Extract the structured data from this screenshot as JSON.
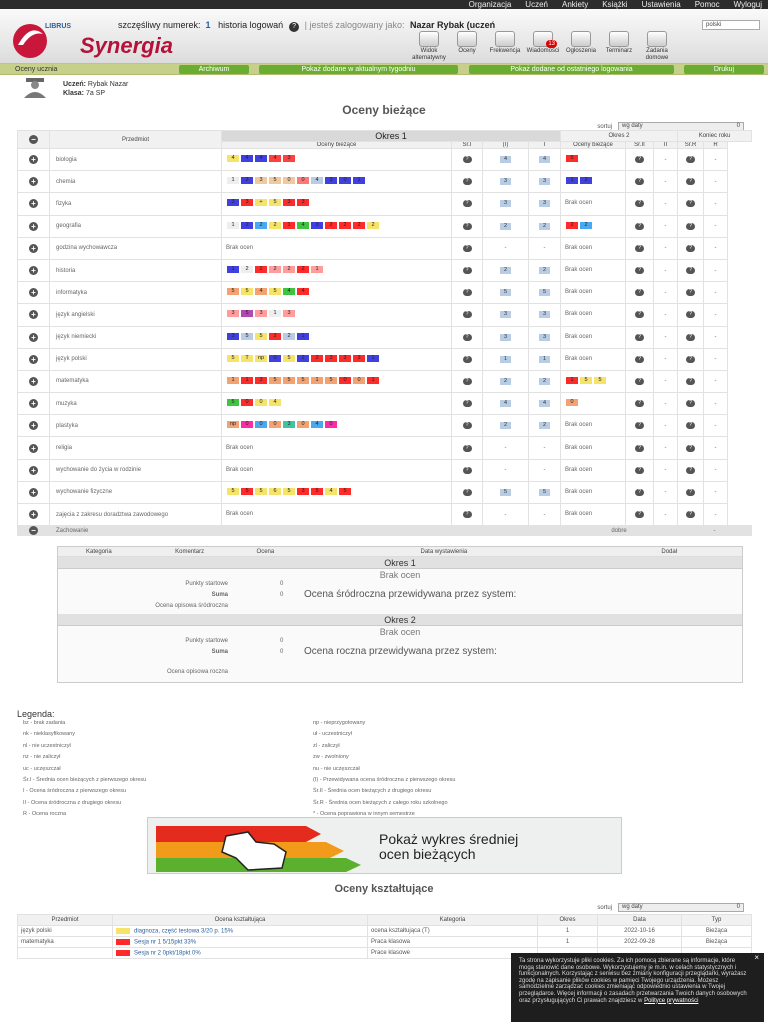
{
  "topnav": [
    "Organizacja",
    "Uczeń",
    "Ankiety",
    "Książki",
    "Ustawienia",
    "Pomoc",
    "Wyloguj"
  ],
  "header": {
    "lucky_label": "szczęśliwy numerek:",
    "lucky_number": "1",
    "log_history": "historia logowań",
    "logged_as": "| jesteś zalogowany jako:",
    "user": "Nazar Rybak (uczeń",
    "lang": "polski",
    "logo_word": "Synergia",
    "logo_small": "LIBRUS"
  },
  "icons": [
    {
      "label": "Widok alternatywny",
      "name": "alt-view"
    },
    {
      "label": "Oceny",
      "name": "grades"
    },
    {
      "label": "Frekwencja",
      "name": "attendance"
    },
    {
      "label": "Wiadomości",
      "name": "messages",
      "badge": "13"
    },
    {
      "label": "Ogłoszenia",
      "name": "announcements"
    },
    {
      "label": "Terminarz",
      "name": "calendar"
    },
    {
      "label": "Zadania domowe",
      "name": "homework"
    }
  ],
  "tabbar": {
    "active": "Oceny ucznia",
    "buttons": [
      "Archiwum",
      "Pokaż dodane w aktualnym tygodniu",
      "Pokaż dodane od ostatniego logowania",
      "Drukuj"
    ]
  },
  "student": {
    "name_label": "Uczeń:",
    "name": "Rybak Nazar",
    "class_label": "Klasa:",
    "class": "7a SP"
  },
  "current_title": "Oceny bieżące",
  "sort": {
    "label": "sortuj",
    "value": "wg daty",
    "count": "0"
  },
  "table_headers": {
    "subject": "Przedmiot",
    "okres1": "Okres 1",
    "okres2": "Okres 2",
    "year_end": "Koniec roku",
    "cur": "Oceny bieżące",
    "sr1": "Śr.I",
    "p1": "(I)",
    "i": "I",
    "cur2": "Oceny bieżące",
    "sr2": "Śr.II",
    "ii": "II",
    "srr": "Śr.R",
    "r": "R"
  },
  "rows": [
    {
      "subject": "biologia",
      "g1": [
        [
          "4",
          "#f6e36a"
        ],
        [
          "4",
          "#4040e0"
        ],
        [
          "4",
          "#4040e0"
        ],
        [
          "4",
          "#ff4040"
        ],
        [
          "3",
          "#ff4040"
        ]
      ],
      "sr1": "4",
      "g2": [
        [
          "5",
          "#ff2a2a"
        ]
      ]
    },
    {
      "subject": "chemia",
      "g1": [
        [
          "1",
          "#eeeeee"
        ],
        [
          "2",
          "#4040e0"
        ],
        [
          "3",
          "#f2c89e"
        ],
        [
          "5",
          "#f2c89e"
        ],
        [
          "0",
          "#f2c89e"
        ],
        [
          "0",
          "#ff7878"
        ],
        [
          "4",
          "#b8cce4"
        ],
        [
          "3",
          "#4040e0"
        ],
        [
          "0",
          "#4040e0"
        ],
        [
          "1",
          "#4040e0"
        ]
      ],
      "sr1": "3",
      "g2": [
        [
          "1",
          "#4040e0"
        ],
        [
          "2",
          "#4040e0"
        ]
      ]
    },
    {
      "subject": "fizyka",
      "g1": [
        [
          "3",
          "#4040e0"
        ],
        [
          "3",
          "#ff2a2a"
        ],
        [
          "+",
          "#f6e36a"
        ],
        [
          "5",
          "#f6e36a"
        ],
        [
          "3",
          "#ff2a2a"
        ],
        [
          "3",
          "#ff2a2a"
        ]
      ],
      "sr1": "3",
      "g2": "Brak ocen"
    },
    {
      "subject": "geografia",
      "g1": [
        [
          "1",
          "#eeeeee"
        ],
        [
          "2",
          "#4040e0"
        ],
        [
          "2",
          "#4aa8f0"
        ],
        [
          "2",
          "#f6e36a"
        ],
        [
          "1",
          "#ff2a2a"
        ],
        [
          "4",
          "#3ec43e"
        ],
        [
          "3",
          "#4040e0"
        ],
        [
          "2",
          "#ff2a2a"
        ],
        [
          "2",
          "#ff2a2a"
        ],
        [
          "2",
          "#ff2a2a"
        ],
        [
          "2",
          "#f6e36a"
        ]
      ],
      "sr1": "2",
      "g2": [
        [
          "2",
          "#ff2a2a"
        ],
        [
          "2",
          "#4aa8f0"
        ]
      ]
    },
    {
      "subject": "godzina wychowawcza",
      "g1": "Brak ocen",
      "sr1": "-",
      "g2": "Brak ocen"
    },
    {
      "subject": "historia",
      "g1": [
        [
          "1",
          "#4040e0"
        ],
        [
          "2",
          "#eeeeee"
        ],
        [
          "2",
          "#ff2a2a"
        ],
        [
          "2",
          "#ff9d9d"
        ],
        [
          "2",
          "#ff9d9d"
        ],
        [
          "2",
          "#ff2a2a"
        ],
        [
          "1",
          "#ff9d9d"
        ]
      ],
      "sr1": "2",
      "g2": "Brak ocen"
    },
    {
      "subject": "informatyka",
      "g1": [
        [
          "5",
          "#f4a272"
        ],
        [
          "5",
          "#f6e36a"
        ],
        [
          "4",
          "#f4a272"
        ],
        [
          "5",
          "#f6e36a"
        ],
        [
          "4",
          "#3ec43e"
        ],
        [
          "4",
          "#ff2a2a"
        ]
      ],
      "sr1": "5",
      "g2": "Brak ocen"
    },
    {
      "subject": "język angielski",
      "g1": [
        [
          "3",
          "#ff9d9d"
        ],
        [
          "5",
          "#b04ab0"
        ],
        [
          "3",
          "#ff9d9d"
        ],
        [
          "1",
          "#eeeeee"
        ],
        [
          "3",
          "#ff9d9d"
        ]
      ],
      "sr1": "3",
      "g2": "Brak ocen"
    },
    {
      "subject": "język niemiecki",
      "g1": [
        [
          "3",
          "#4040e0"
        ],
        [
          "5",
          "#b8cce4"
        ],
        [
          "5",
          "#f6e36a"
        ],
        [
          "2",
          "#ff2a2a"
        ],
        [
          "2",
          "#b8cce4"
        ],
        [
          "1",
          "#4040e0"
        ]
      ],
      "sr1": "3",
      "g2": "Brak ocen"
    },
    {
      "subject": "język polski",
      "g1": [
        [
          "5",
          "#f6e36a"
        ],
        [
          "T",
          "#f6e36a"
        ],
        [
          "np",
          "#f6e36a"
        ],
        [
          "0",
          "#4040e0"
        ],
        [
          "5",
          "#f6e36a"
        ],
        [
          "2",
          "#4040e0"
        ],
        [
          "2",
          "#ff2a2a"
        ],
        [
          "3",
          "#ff2a2a"
        ],
        [
          "3",
          "#ff2a2a"
        ],
        [
          "3",
          "#ff2a2a"
        ],
        [
          "1",
          "#4040e0"
        ]
      ],
      "sr1": "1",
      "g2": "Brak ocen"
    },
    {
      "subject": "matematyka",
      "g1": [
        [
          "1",
          "#f4a272"
        ],
        [
          "1",
          "#ff2a2a"
        ],
        [
          "3",
          "#ff2a2a"
        ],
        [
          "5",
          "#f4a272"
        ],
        [
          "5",
          "#f4a272"
        ],
        [
          "5",
          "#f4a272"
        ],
        [
          "1",
          "#f4a272"
        ],
        [
          "5",
          "#f4a272"
        ],
        [
          "0",
          "#ff2a2a"
        ],
        [
          "0",
          "#f4a272"
        ],
        [
          "1",
          "#ff2a2a"
        ]
      ],
      "sr1": "2",
      "g2": [
        [
          "1",
          "#ff2a2a"
        ],
        [
          "5",
          "#f6e36a"
        ],
        [
          "5",
          "#f6e36a"
        ]
      ]
    },
    {
      "subject": "muzyka",
      "g1": [
        [
          "5",
          "#3ec43e"
        ],
        [
          "0",
          "#ff2a2a"
        ],
        [
          "0",
          "#f6e36a"
        ],
        [
          "4",
          "#f6e36a"
        ]
      ],
      "sr1": "4",
      "g2": [
        [
          "0",
          "#f4a272"
        ]
      ]
    },
    {
      "subject": "plastyka",
      "g1": [
        [
          "np",
          "#f4a272"
        ],
        [
          "0",
          "#ff2aa8"
        ],
        [
          "0",
          "#4aa8f0"
        ],
        [
          "0",
          "#f4a272"
        ],
        [
          "3",
          "#3ec4a0"
        ],
        [
          "0",
          "#f4a272"
        ],
        [
          "4",
          "#4aa8f0"
        ],
        [
          "0",
          "#ff2aa8"
        ]
      ],
      "sr1": "2",
      "g2": "Brak ocen"
    },
    {
      "subject": "religia",
      "g1": "Brak ocen",
      "sr1": "-",
      "g2": "Brak ocen"
    },
    {
      "subject": "wychowanie do życia w rodzinie",
      "g1": "Brak ocen",
      "sr1": "-",
      "g2": "Brak ocen"
    },
    {
      "subject": "wychowanie fizyczne",
      "g1": [
        [
          "5",
          "#f6e36a"
        ],
        [
          "5",
          "#ff2a2a"
        ],
        [
          "5",
          "#f6e36a"
        ],
        [
          "6",
          "#f6e36a"
        ],
        [
          "5",
          "#f6e36a"
        ],
        [
          "3",
          "#ff2a2a"
        ],
        [
          "5",
          "#ff2a2a"
        ],
        [
          "4",
          "#f6e36a"
        ],
        [
          "5",
          "#ff2a2a"
        ]
      ],
      "sr1": "5",
      "g2": "Brak ocen"
    },
    {
      "subject": "zajęcia z zakresu doradztwa zawodowego",
      "g1": "Brak ocen",
      "sr1": "-",
      "g2": "Brak ocen"
    }
  ],
  "behaviour": {
    "label": "Zachowanie",
    "value": "dobre",
    "r": "-",
    "cols": [
      "Kategoria",
      "Komentarz",
      "Ocena",
      "Data wystawienia",
      "Dodał"
    ],
    "okres1": "Okres 1",
    "okres2": "Okres 2",
    "no_grades": "Brak ocen",
    "start": "Punkty startowe",
    "sum": "Suma",
    "zero": "0",
    "mid_desc": "Ocena opisowa śródroczna",
    "mid_pred": "Ocena śródroczna przewidywana przez system:",
    "year_desc": "Ocena opisowa roczna",
    "year_pred": "Ocena roczna przewidywana przez system:"
  },
  "legend": {
    "title": "Legenda:",
    "col1": [
      "bz - brak zadania",
      "nk - nieklasyfikowany",
      "nl - nie uczestniczył",
      "nz - nie zaliczył",
      "uc - uczęszczał"
    ],
    "col2": [
      "np - nieprzygotowany",
      "uł - uczestniczył",
      "zl - zaliczył",
      "zw - zwolniony",
      "nu - nie uczęszczał"
    ],
    "wide": [
      "Śr.I - Średnia ocen bieżących z pierwszego okresu",
      "I - Ocena śródroczna z pierwszego okresu",
      "II - Ocena śródroczna z drugiego okresu",
      "R - Ocena roczna"
    ],
    "wide2": [
      "(I) - Przewidywana ocena śródroczna z pierwszego okresu",
      "Śr.II - Średnia ocen bieżących z drugiego okresu",
      "Śr.R - Średnia ocen bieżących z całego roku szkolnego",
      "* - Ocena poprawiona w innym semestrze"
    ]
  },
  "banner": {
    "line1": "Pokaż wykres średniej",
    "line2": "ocen bieżących"
  },
  "formative": {
    "title": "Oceny kształtujące",
    "sort": {
      "label": "sortuj",
      "value": "wg daty",
      "count": "0"
    },
    "headers": [
      "Przedmiot",
      "Ocena kształtująca",
      "Kategoria",
      "Okres",
      "Data",
      "Typ"
    ],
    "rows": [
      {
        "subject": "język polski",
        "grade": "diagnoza, część testowa 3/20 p. 15%",
        "color": "#f6e36a",
        "category": "ocena kształtująca (T)",
        "period": "1",
        "date": "2022-10-16",
        "type": "Bieżąca"
      },
      {
        "subject": "matematyka",
        "grade": "Sesja nr 1 5/15pkt 33%",
        "color": "#ff2a2a",
        "category": "Praca klasowa",
        "period": "1",
        "date": "2022-09-28",
        "type": "Bieżąca"
      },
      {
        "subject": "",
        "grade": "Sesja nr 2 0pkt/18pkt 0%",
        "color": "#ff2a2a",
        "category": "Prace klasowe",
        "period": "",
        "date": "",
        "type": ""
      }
    ]
  },
  "cookie": {
    "text": "Ta strona wykorzystuje pliki cookies. Za ich pomocą zbierane są informacje, które mogą stanowić dane osobowe. Wykorzystujemy je m.in. w celach statystycznych i funkcjonalnych. Korzystając z serwisu bez zmiany konfiguracji przeglądarki, wyrażasz zgodę na zapisanie plików cookies w pamięci Twojego urządzenia. Możesz samodzielnie zarządzać cookies zmieniając odpowiednio ustawienia w Twojej przeglądarce. Więcej informacji o zasadach przetwarzania Twoich danych osobowych oraz przysługujących Ci prawach znajdziesz w",
    "link": "Polityce prywatności",
    "close": "×"
  },
  "colors": {
    "accent_green": "#6aad32",
    "tab_bar": "#c7d08a",
    "logo_red": "#c8173a"
  }
}
